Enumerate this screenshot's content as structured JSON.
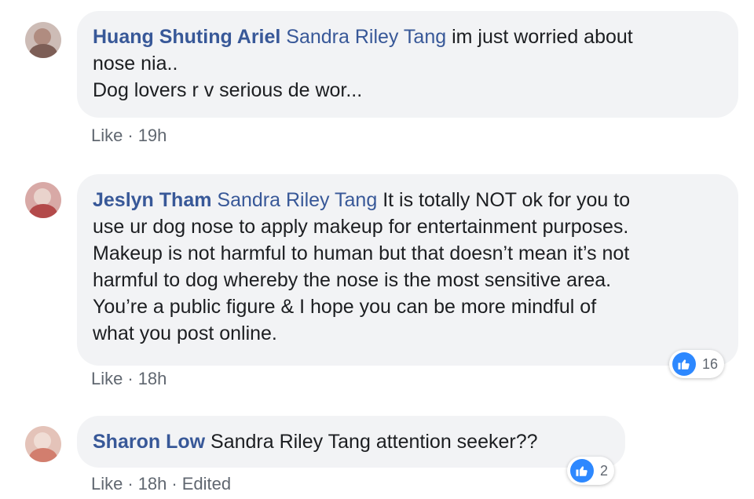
{
  "colors": {
    "author": "#385898",
    "bubble_bg": "#f2f3f5",
    "meta_text": "#606770",
    "like_blue": "#2d88ff"
  },
  "comments": [
    {
      "author": "Huang Shuting Ariel",
      "mention": "Sandra Riley Tang",
      "text_line1": "im just worried about",
      "text_line2": "nose nia..",
      "text_line3": "Dog lovers r v serious de wor...",
      "like_label": "Like",
      "separator": "·",
      "time": "19h"
    },
    {
      "author": "Jeslyn Tham",
      "mention": "Sandra Riley Tang",
      "text_line1": "It is totally NOT ok for you to",
      "text_line2": "use ur dog nose to apply makeup for entertainment purposes.",
      "text_line3": "Makeup is not harmful to human but that doesn’t mean it’s not",
      "text_line4": "harmful to dog whereby the nose is the most sensitive area.",
      "text_line5": "You’re a public figure & I hope you can be more mindful of",
      "text_line6": "what you post online.",
      "like_label": "Like",
      "separator": "·",
      "time": "18h",
      "reaction_icon": "thumbs-up-icon",
      "reaction_count": "16"
    },
    {
      "author": "Sharon Low",
      "mention": "Sandra Riley Tang",
      "text_line1": "attention seeker??",
      "like_label": "Like",
      "separator": "·",
      "time": "18h",
      "separator2": "·",
      "edited": "Edited",
      "reaction_icon": "thumbs-up-icon",
      "reaction_count": "2"
    }
  ]
}
